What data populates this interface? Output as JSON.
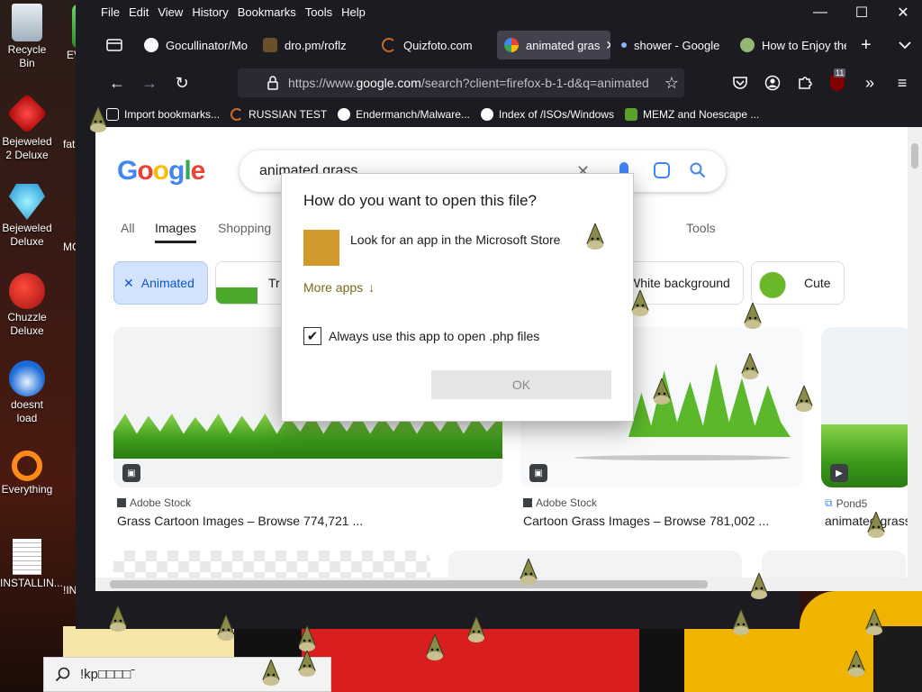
{
  "desktop": {
    "icons": [
      {
        "label": "Recycle Bin",
        "icon": "recycle-bin-icon"
      },
      {
        "label": "Bejeweled 2 Deluxe",
        "icon": "bejeweled2-icon"
      },
      {
        "label": "Bejeweled Deluxe",
        "icon": "bejeweled-icon"
      },
      {
        "label": "Chuzzle Deluxe",
        "icon": "chuzzle-icon"
      },
      {
        "label": "doesnt load",
        "icon": "thunderbird-icon"
      },
      {
        "label": "Everything",
        "icon": "everything-search-icon"
      },
      {
        "label": "INSTALLIN...",
        "icon": "text-file-icon"
      }
    ],
    "partial_labels": [
      "EVIL",
      "M",
      "fat",
      "MC",
      "!IN"
    ]
  },
  "taskbar": {
    "search_text": "!kp□□□□ˉ"
  },
  "firefox": {
    "menu": [
      "File",
      "Edit",
      "View",
      "History",
      "Bookmarks",
      "Tools",
      "Help"
    ],
    "window_controls": {
      "minimize": "—",
      "maximize": "☐",
      "close": "✕"
    },
    "tabs": [
      {
        "label": "Gocullinator/Mo",
        "icon": "github-icon",
        "color": "#24292f"
      },
      {
        "label": "dro.pm/roflz",
        "icon": "page-icon",
        "color": "#6b4e2a"
      },
      {
        "label": "Quizfoto.com",
        "icon": "loading-icon",
        "color": "#c56b2a"
      },
      {
        "label": "animated gras",
        "icon": "google-icon",
        "color": "#4285f4",
        "active": true
      },
      {
        "label": "shower - Google",
        "icon": "dot-icon",
        "color": "#8ab4f8"
      },
      {
        "label": "How to Enjoy the",
        "icon": "wikihow-icon",
        "color": "#93b874"
      }
    ],
    "new_tab": "+",
    "url": {
      "prefix": "https://www.",
      "host": "google.com",
      "rest": "/search?client=firefox-b-1-d&q=animated"
    },
    "extension_badge": "11",
    "bookmarks": [
      {
        "label": "Import bookmarks...",
        "color": "#fbfbfe"
      },
      {
        "label": "RUSSIAN TEST",
        "color": "#c56b2a"
      },
      {
        "label": "Endermanch/Malware...",
        "color": "#ffffff"
      },
      {
        "label": "Index of /ISOs/Windows",
        "color": "#ffffff"
      },
      {
        "label": "MEMZ and Noescape ...",
        "color": "#5aa02c"
      }
    ]
  },
  "google": {
    "logo": "Google",
    "query": "animated grass",
    "tabs": [
      "All",
      "Images",
      "Shopping",
      "Tools"
    ],
    "selected_tab": "Images",
    "chips": [
      {
        "label": "Animated",
        "selected": true,
        "prefix": "✕"
      },
      {
        "label": "Tr"
      },
      {
        "label": "White background"
      },
      {
        "label": "Cute"
      }
    ],
    "results": [
      {
        "source": "Adobe Stock",
        "title": "Grass Cartoon Images – Browse 774,721 ..."
      },
      {
        "source": "Adobe Stock",
        "title": "Cartoon Grass Images – Browse 781,002 ..."
      },
      {
        "source": "Pond5",
        "title": "animated grass"
      }
    ]
  },
  "dialog": {
    "title": "How do you want to open this file?",
    "store_option": "Look for an app in the Microsoft Store",
    "more_apps": "More apps",
    "more_apps_arrow": "↓",
    "checkbox_label": "Always use this app to open .php files",
    "checkbox_checked": true,
    "checkmark": "✔",
    "ok_label": "OK"
  }
}
